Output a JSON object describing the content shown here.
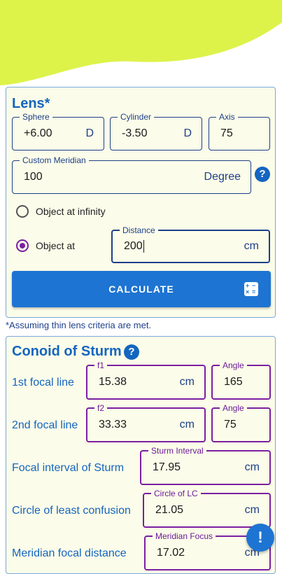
{
  "lens": {
    "title": "Lens*",
    "sphere": {
      "label": "Sphere",
      "value": "+6.00",
      "unit": "D"
    },
    "cylinder": {
      "label": "Cylinder",
      "value": "-3.50",
      "unit": "D"
    },
    "axis": {
      "label": "Axis",
      "value": "75"
    },
    "custom_meridian": {
      "label": "Custom Meridian",
      "value": "100",
      "unit": "Degree"
    },
    "help_icon": "?",
    "object_infinity_label": "Object at infinity",
    "object_at_label": "Object at",
    "distance": {
      "label": "Distance",
      "value": "200",
      "unit": "cm"
    },
    "calculate_label": "CALCULATE"
  },
  "note": "*Assuming thin lens criteria are met.",
  "sturm": {
    "title": "Conoid of Sturm",
    "help_icon": "?",
    "first_focal": {
      "label": "1st focal line",
      "field_label": "f1",
      "value": "15.38",
      "unit": "cm",
      "angle_label": "Angle",
      "angle_value": "165"
    },
    "second_focal": {
      "label": "2nd focal line",
      "field_label": "f2",
      "value": "33.33",
      "unit": "cm",
      "angle_label": "Angle",
      "angle_value": "75"
    },
    "interval": {
      "label": "Focal interval of Sturm",
      "field_label": "Sturm Interval",
      "value": "17.95",
      "unit": "cm"
    },
    "circle": {
      "label": "Circle of least confusion",
      "field_label": "Circle of LC",
      "value": "21.05",
      "unit": "cm"
    },
    "meridian": {
      "label": "Meridian focal distance",
      "field_label": "Meridian Focus",
      "value": "17.02",
      "unit": "cm"
    }
  },
  "fab_icon": "!",
  "colors": {
    "wave": "#ddf34a",
    "accent": "#1e74d2",
    "output_border": "#7b1fa2",
    "card_bg": "#fbfce9"
  }
}
